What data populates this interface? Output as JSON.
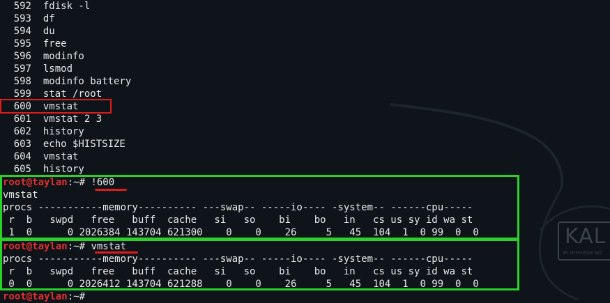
{
  "history": [
    {
      "num": "592",
      "cmd": "fdisk -l"
    },
    {
      "num": "593",
      "cmd": "df"
    },
    {
      "num": "594",
      "cmd": "du"
    },
    {
      "num": "595",
      "cmd": "free"
    },
    {
      "num": "596",
      "cmd": "modinfo"
    },
    {
      "num": "597",
      "cmd": "lsmod"
    },
    {
      "num": "598",
      "cmd": "modinfo battery"
    },
    {
      "num": "599",
      "cmd": "stat /root"
    },
    {
      "num": "600",
      "cmd": "vmstat"
    },
    {
      "num": "601",
      "cmd": "vmstat 2 3"
    },
    {
      "num": "602",
      "cmd": "history"
    },
    {
      "num": "603",
      "cmd": "echo $HISTSIZE"
    },
    {
      "num": "604",
      "cmd": "vmstat"
    },
    {
      "num": "605",
      "cmd": "history"
    }
  ],
  "prompt": {
    "user_host": "root@taylan",
    "path": ":~# "
  },
  "block1": {
    "command": "!600",
    "echo": "vmstat",
    "header1": "procs -----------memory---------- ---swap-- -----io---- -system-- ------cpu-----",
    "header2": " r  b   swpd   free   buff  cache   si   so    bi    bo   in   cs us sy id wa st",
    "values": " 1  0      0 2026384 143704 621300    0    0    26     5   45  104  1  0 99  0  0"
  },
  "block2": {
    "command": "vmstat",
    "header1": "procs -----------memory---------- ---swap-- -----io---- -system-- ------cpu-----",
    "header2": " r  b   swpd   free   buff  cache   si   so    bi    bo   in   cs us sy id wa st",
    "values": " 0  0      0 2026412 143704 621288    0    0    26     5   45  104  1  0 99  0  0"
  },
  "final_prompt_cmd": "",
  "logo": {
    "text": "KAL",
    "sub": "BY OFFENSIVE SEC"
  },
  "colors": {
    "background": "#0e1419",
    "prompt_user": "#e03030",
    "highlight_red": "#e01b1b",
    "highlight_green": "#2ad12a"
  }
}
